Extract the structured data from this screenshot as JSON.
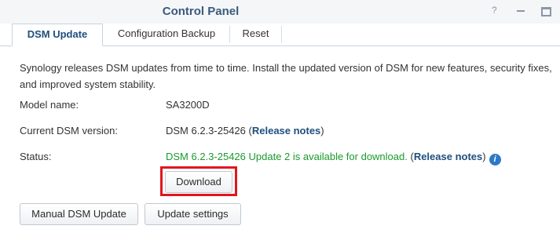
{
  "window": {
    "title": "Control Panel",
    "controls": [
      "help-icon",
      "minimize-icon",
      "maximize-icon"
    ],
    "help_glyph": "?"
  },
  "tabs": [
    {
      "label": "DSM Update",
      "active": true
    },
    {
      "label": "Configuration Backup",
      "active": false
    },
    {
      "label": "Reset",
      "active": false
    }
  ],
  "description": "Synology releases DSM updates from time to time. Install the updated version of DSM for new features, security fixes, and improved system stability.",
  "fields": {
    "model": {
      "label": "Model name:",
      "value": "SA3200D"
    },
    "current_version": {
      "label": "Current DSM version:",
      "value": "DSM 6.2.3-25426",
      "open_paren": " (",
      "link": "Release notes",
      "close_paren": ")"
    },
    "status": {
      "label": "Status:",
      "value": "DSM 6.2.3-25426 Update 2 is available for download.",
      "open_paren": " (",
      "link": "Release notes",
      "close_paren": ")",
      "info_glyph": "i"
    }
  },
  "buttons": {
    "download": "Download",
    "manual_update": "Manual DSM Update",
    "update_settings": "Update settings"
  },
  "colors": {
    "status_green": "#1a9a2c",
    "link_blue": "#1f4f7e",
    "highlight_red": "#e1161f",
    "title_blue": "#3b5a7c"
  }
}
